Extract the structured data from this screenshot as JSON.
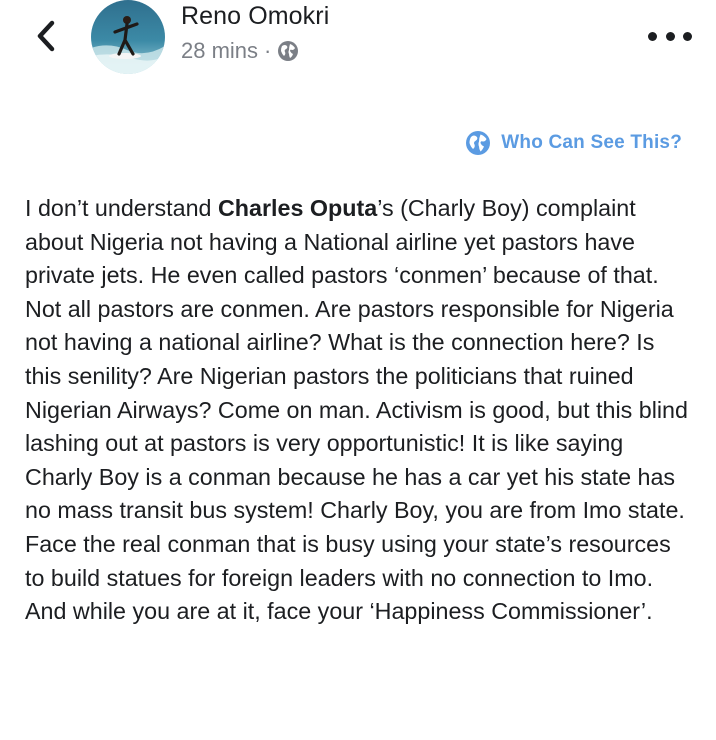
{
  "header": {
    "author_name": "Reno Omokri",
    "timestamp": "28 mins",
    "separator": "·",
    "audience_icon": "globe-icon",
    "back_icon": "chevron-left-icon",
    "more_icon": "more-dots-icon"
  },
  "privacy": {
    "label": "Who Can See This?",
    "icon": "globe-icon",
    "color": "#5b9be2"
  },
  "post": {
    "part1": "I don’t understand ",
    "mention": "Charles Oputa",
    "part2": "’s (Charly Boy) complaint about Nigeria not having a National airline yet pastors have private jets. He even called pastors ‘conmen’ because of that. Not all pastors are conmen. Are pastors responsible for Nigeria not having a national airline? What is the connection here? Is this senility? Are Nigerian pastors the politicians that ruined Nigerian Airways? Come on man. Activism is good, but this blind lashing out at pastors is very opportunistic! It is like saying Charly Boy is a conman because he has a car yet his state has no mass transit bus system! Charly Boy, you are from Imo state. Face the real conman that is busy using your state’s resources to build statues for foreign leaders with no connection to Imo. And while you are at it, face your ‘Happiness Commissioner’."
  },
  "colors": {
    "text": "#1c1e21",
    "meta": "#7b7f86",
    "link": "#5b9be2"
  }
}
